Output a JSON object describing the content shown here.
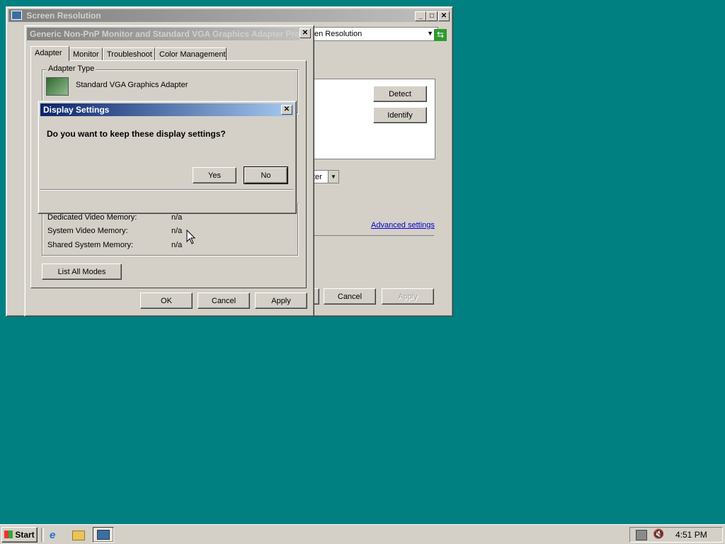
{
  "screen_resolution_window": {
    "title": "Screen Resolution",
    "address_text": "en Resolution",
    "detect_label": "Detect",
    "identify_label": "Identify",
    "orientation_partial": "ter",
    "advanced_settings_label": "Advanced settings",
    "cancel_label": "Cancel",
    "apply_label": "Apply"
  },
  "adapter_properties": {
    "title": "Generic Non-PnP Monitor and Standard VGA Graphics Adapter Properties",
    "tabs": [
      {
        "label": "Adapter"
      },
      {
        "label": "Monitor"
      },
      {
        "label": "Troubleshoot"
      },
      {
        "label": "Color Management"
      }
    ],
    "adapter_type_label": "Adapter Type",
    "adapter_name": "Standard VGA Graphics Adapter",
    "memory": [
      {
        "label": "Dedicated Video Memory:",
        "value": "n/a"
      },
      {
        "label": "System Video Memory:",
        "value": "n/a"
      },
      {
        "label": "Shared System Memory:",
        "value": "n/a"
      }
    ],
    "list_all_modes_label": "List All Modes",
    "ok_label": "OK",
    "cancel_label": "Cancel",
    "apply_label": "Apply"
  },
  "display_settings_dialog": {
    "title": "Display Settings",
    "question": "Do you want to keep these display settings?",
    "yes_label": "Yes",
    "no_label": "No"
  },
  "taskbar": {
    "start_label": "Start",
    "clock": "4:51 PM"
  },
  "colors": {
    "desktop": "#008080",
    "active_title_start": "#0a246a",
    "active_title_end": "#a6caf0",
    "face": "#d4d0c8"
  }
}
